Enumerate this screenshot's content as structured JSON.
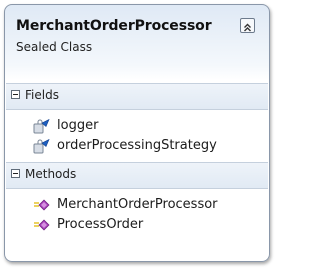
{
  "class": {
    "name": "MerchantOrderProcessor",
    "stereotype": "Sealed Class",
    "collapse_icon": "double-chevron-up-icon"
  },
  "sections": {
    "fields": {
      "label": "Fields",
      "items": [
        {
          "label": "logger",
          "icon": "private-field-icon"
        },
        {
          "label": "orderProcessingStrategy",
          "icon": "private-field-icon"
        }
      ]
    },
    "methods": {
      "label": "Methods",
      "items": [
        {
          "label": "MerchantOrderProcessor",
          "icon": "public-method-icon"
        },
        {
          "label": "ProcessOrder",
          "icon": "public-method-icon"
        }
      ]
    }
  },
  "colors": {
    "border": "#8a97a9",
    "header_gradient_top": "#dfe9f5",
    "field_icon": "#1f5fbf",
    "method_icon": "#a33bb7"
  }
}
